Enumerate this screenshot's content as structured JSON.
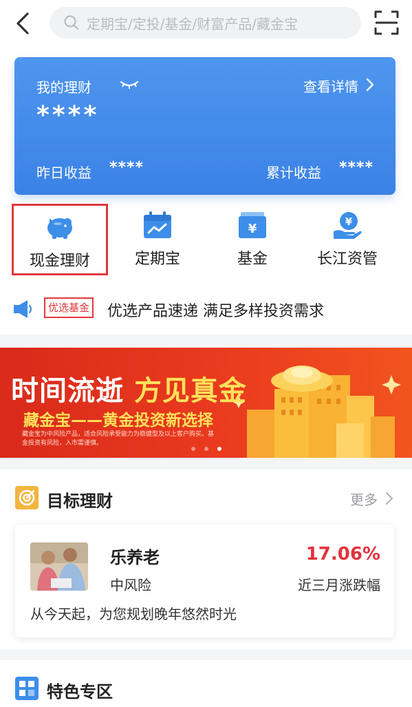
{
  "topbar": {
    "search_placeholder": "定期宝/定投/基金/财富产品/藏金宝"
  },
  "card": {
    "title": "我的理财",
    "detail_label": "查看详情",
    "balance_masked": "****",
    "yesterday_label": "昨日收益",
    "yesterday_value": "****",
    "total_label": "累计收益",
    "total_value": "****"
  },
  "entries": [
    {
      "label": "现金理财",
      "icon": "piggy-bank-icon"
    },
    {
      "label": "定期宝",
      "icon": "calendar-icon"
    },
    {
      "label": "基金",
      "icon": "yuan-box-icon"
    },
    {
      "label": "长江资管",
      "icon": "yuan-hand-icon"
    }
  ],
  "notice": {
    "tag": "优选基金",
    "text": "优选产品速递 满足多样投资需求"
  },
  "banner": {
    "headline_part1": "时间流逝",
    "headline_part2": "方见真金",
    "subline": "藏金宝——黄金投资新选择",
    "disclaimer": "藏金宝为中风险产品，适合风险承受能力为稳健型及以上客户购买。基金投资有风险，入市需谨慎。",
    "page_count": 3,
    "active_page": 3
  },
  "target_section": {
    "title": "目标理财",
    "more_label": "更多",
    "product": {
      "name": "乐养老",
      "risk": "中风险",
      "rate": "17.06%",
      "rate_label": "近三月涨跌幅",
      "description": "从今天起，为您规划晚年悠然时光"
    }
  },
  "featured_section": {
    "title": "特色专区"
  },
  "colors": {
    "primary_blue": "#3b82e6",
    "accent_red": "#e4373a",
    "rate_red": "#e2333b",
    "banner_red": "#e33520",
    "gold": "#ffe15a"
  }
}
